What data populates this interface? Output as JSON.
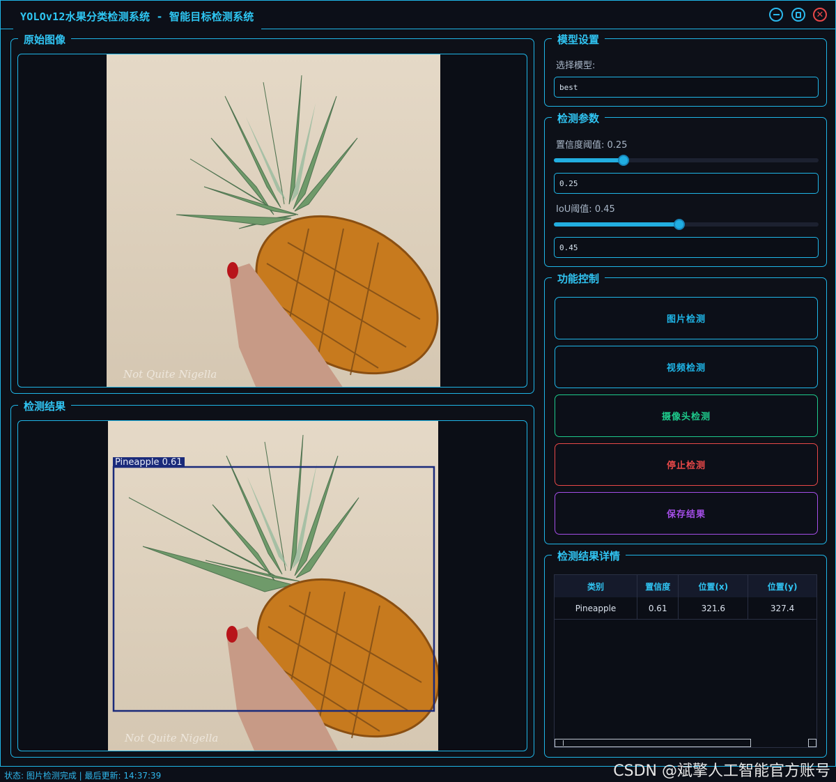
{
  "window": {
    "title": "YOLOv12水果分类检测系统 - 智能目标检测系统",
    "accent": "#1fb6e8"
  },
  "panels": {
    "original": {
      "title": "原始图像",
      "watermark": "Not Quite Nigella"
    },
    "result": {
      "title": "检测结果",
      "watermark": "Not Quite Nigella",
      "box_label": "Pineapple 0.61",
      "box_color": "#1a2a7a"
    }
  },
  "model": {
    "title": "模型设置",
    "select_label": "选择模型:",
    "selected": "best"
  },
  "params": {
    "title": "检测参数",
    "conf_label": "置信度阈值: 0.25",
    "conf_value": "0.25",
    "conf_fraction": 0.25,
    "iou_label": "IoU阈值: 0.45",
    "iou_value": "0.45",
    "iou_fraction": 0.45
  },
  "controls": {
    "title": "功能控制",
    "buttons": [
      {
        "label": "图片检测",
        "color": "#1fb6e8"
      },
      {
        "label": "视频检测",
        "color": "#1fb6e8"
      },
      {
        "label": "摄像头检测",
        "color": "#1ecb8c"
      },
      {
        "label": "停止检测",
        "color": "#e84848"
      },
      {
        "label": "保存结果",
        "color": "#a54ee8"
      }
    ]
  },
  "details": {
    "title": "检测结果详情",
    "headers": [
      "类别",
      "置信度",
      "位置(x)",
      "位置(y)"
    ],
    "rows": [
      [
        "Pineapple",
        "0.61",
        "321.6",
        "327.4"
      ]
    ]
  },
  "status": {
    "text": "状态: 图片检测完成 | 最后更新: 14:37:39"
  },
  "watermark": "CSDN @斌擎人工智能官方账号",
  "icons": {
    "minimize": "minimize-icon",
    "maximize": "maximize-icon",
    "close": "close-icon"
  }
}
